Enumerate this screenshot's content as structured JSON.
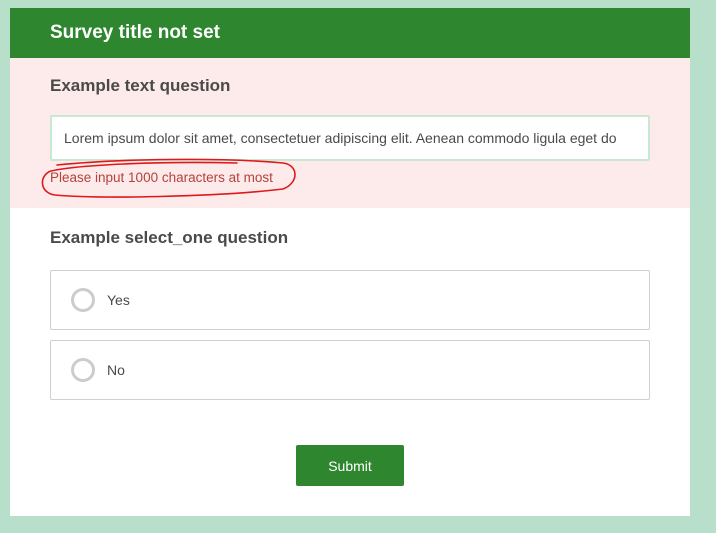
{
  "survey": {
    "title": "Survey title not set"
  },
  "text_question": {
    "label": "Example text question",
    "value": "Lorem ipsum dolor sit amet, consectetuer adipiscing elit. Aenean commodo ligula eget do",
    "error": "Please input 1000 characters at most"
  },
  "select_question": {
    "label": "Example select_one question",
    "options": [
      {
        "label": "Yes"
      },
      {
        "label": "No"
      }
    ]
  },
  "submit": {
    "label": "Submit"
  },
  "colors": {
    "header_bg": "#2e862f",
    "error_bg": "#fcebea",
    "error_text": "#b5413a",
    "annotation": "#e0181b",
    "page_bg": "#b8dfc9"
  }
}
